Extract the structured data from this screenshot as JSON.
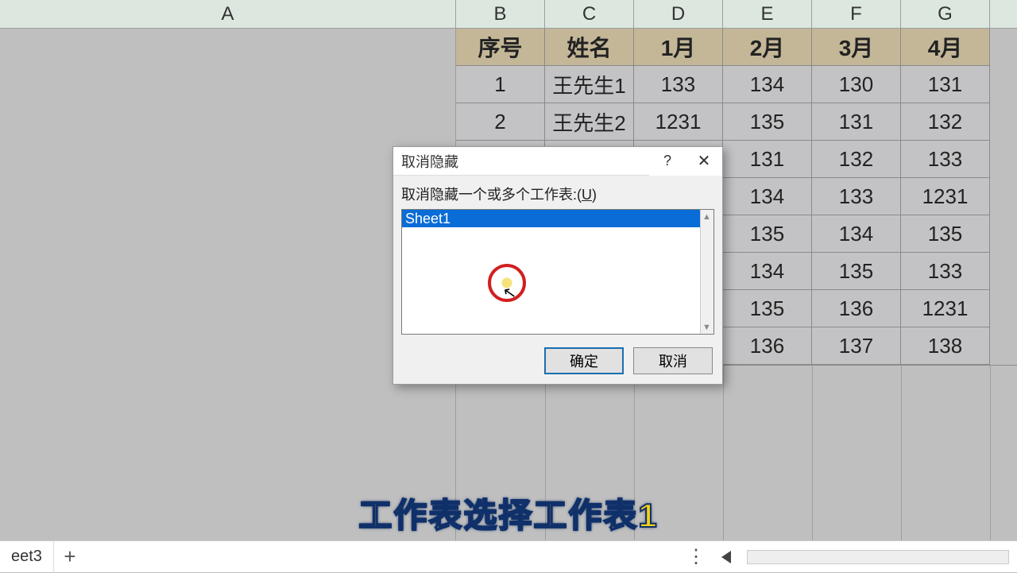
{
  "columns": [
    "A",
    "B",
    "C",
    "D",
    "E",
    "F",
    "G"
  ],
  "table": {
    "headers": [
      "序号",
      "姓名",
      "1月",
      "2月",
      "3月",
      "4月"
    ],
    "rows": [
      [
        "1",
        "王先生1",
        "133",
        "134",
        "130",
        "131"
      ],
      [
        "2",
        "王先生2",
        "1231",
        "135",
        "131",
        "132"
      ],
      [
        "",
        "",
        "",
        "131",
        "132",
        "133"
      ],
      [
        "",
        "",
        "",
        "134",
        "133",
        "1231"
      ],
      [
        "",
        "",
        "",
        "135",
        "134",
        "135"
      ],
      [
        "",
        "",
        "",
        "134",
        "135",
        "133"
      ],
      [
        "",
        "",
        "",
        "135",
        "136",
        "1231"
      ],
      [
        "",
        "",
        "",
        "136",
        "137",
        "138"
      ]
    ]
  },
  "dialog": {
    "title": "取消隐藏",
    "help": "?",
    "close": "✕",
    "label_pre": "取消隐藏一个或多个工作表:(",
    "label_u": "U",
    "label_post": ")",
    "items": [
      "Sheet1"
    ],
    "ok": "确定",
    "cancel": "取消"
  },
  "subtitle": "工作表选择工作表1",
  "tabs": {
    "visible": "eet3",
    "add": "+"
  }
}
